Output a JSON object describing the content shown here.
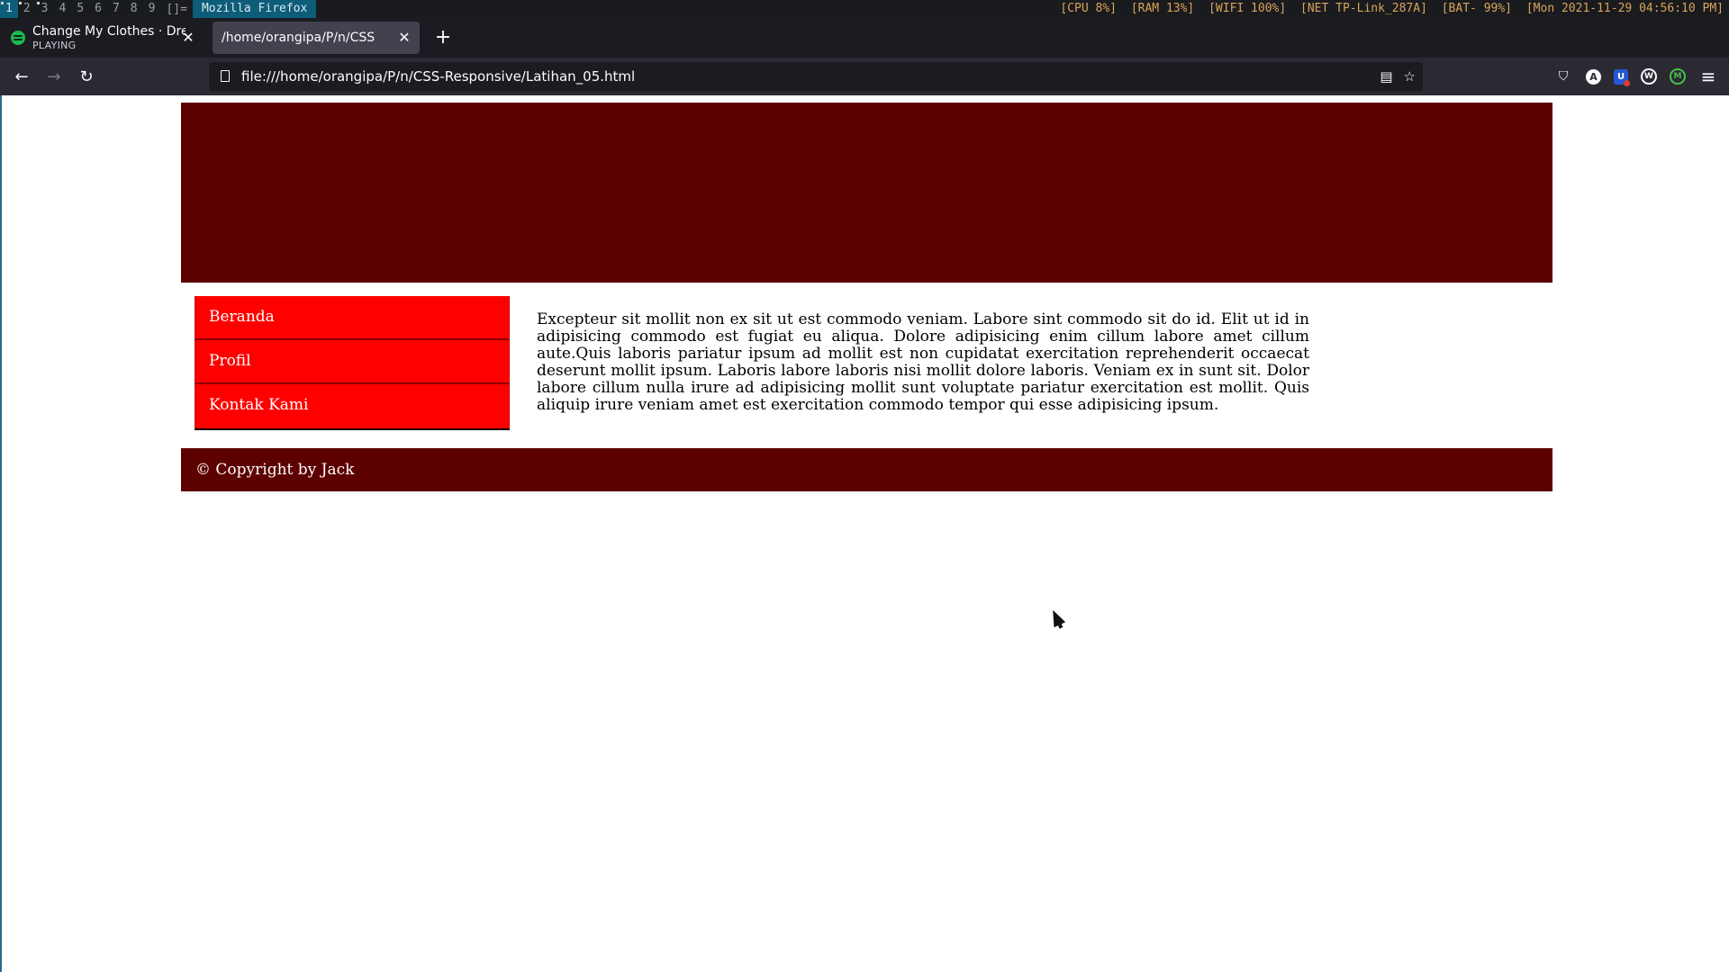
{
  "wm": {
    "workspaces": [
      "1",
      "2",
      "3",
      "4",
      "5",
      "6",
      "7",
      "8",
      "9"
    ],
    "active_workspace": "1",
    "layout": "[]=",
    "window_title": "Mozilla Firefox",
    "status": {
      "cpu": "[CPU 8%]",
      "ram": "[RAM 13%]",
      "wifi": "[WIFI 100%]",
      "net": "[NET TP-Link_287A]",
      "bat": "[BAT- 99%]",
      "datetime": "[Mon 2021-11-29 04:56:10 PM]"
    }
  },
  "tabs": [
    {
      "title": "Change My Clothes · Dream",
      "subtitle": "PLAYING",
      "favicon": "spotify-icon"
    },
    {
      "title": "/home/orangipa/P/n/CSS-Responsive",
      "active": true
    }
  ],
  "navbar": {
    "url": "file:///home/orangipa/P/n/CSS-Responsive/Latihan_05.html"
  },
  "page": {
    "nav": [
      "Beranda",
      "Profil",
      "Kontak Kami"
    ],
    "content": "Excepteur sit mollit non ex sit ut est commodo veniam. Labore sint commodo sit do id. Elit ut id in adipisicing commodo est fugiat eu aliqua. Dolore adipisicing enim cillum labore amet cillum aute.Quis laboris pariatur ipsum ad mollit est non cupidatat exercitation reprehenderit occaecat deserunt mollit ipsum. Laboris labore laboris nisi mollit dolore laboris. Veniam ex in sunt sit. Dolor labore cillum nulla irure ad adipisicing mollit sunt voluptate pariatur exercitation est mollit. Quis aliquip irure veniam amet est exercitation commodo tempor qui esse adipisicing ipsum.",
    "footer": "© Copyright by Jack"
  },
  "colors": {
    "header": "#5d0000",
    "nav_item": "#ff0000",
    "footer": "#5d0000"
  }
}
